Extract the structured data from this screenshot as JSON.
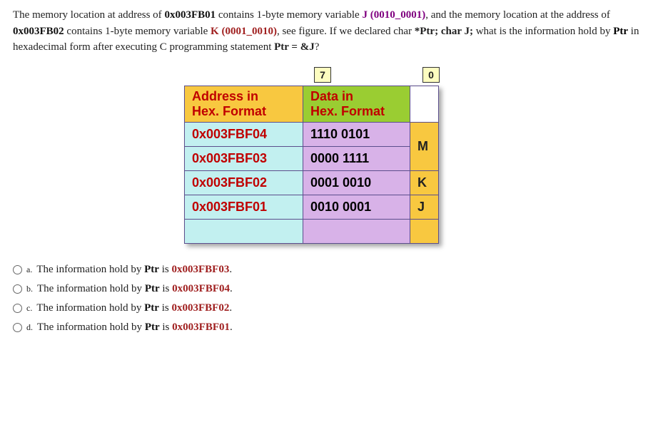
{
  "question": {
    "p1a": "The memory location at address of ",
    "addr1": "0x003FB01",
    "p1b": " contains 1-byte memory variable ",
    "varJ": "J (0010_0001)",
    "p1c": ", and the memory location at the address of ",
    "addr2": "0x003FB02",
    "p1d": " contains 1-byte memory variable ",
    "varK": "K (0001_0010)",
    "p1e": ", see figure. If we declared char ",
    "decl": "*Ptr; char J;",
    "p1f": " what is the information hold by ",
    "ptr": "Ptr",
    "p1g": " in hexadecimal form after executing C programming statement ",
    "stmt": "Ptr = &J",
    "p1h": "?"
  },
  "bits": {
    "hi": "7",
    "lo": "0"
  },
  "table": {
    "head": {
      "addr_l1": "Address in",
      "addr_l2": "Hex. Format",
      "data_l1": "Data in",
      "data_l2": "Hex. Format"
    },
    "rows": [
      {
        "addr": "0x003FBF04",
        "data": "1110 0101",
        "var": "M",
        "var_row": 0
      },
      {
        "addr": "0x003FBF03",
        "data": "0000 1111",
        "var": "",
        "var_row": 0
      },
      {
        "addr": "0x003FBF02",
        "data": "0001 0010",
        "var": "K",
        "var_row": 1
      },
      {
        "addr": "0x003FBF01",
        "data": "0010 0001",
        "var": "J",
        "var_row": 1
      }
    ]
  },
  "options": [
    {
      "letter": "a.",
      "pre": "The information hold by  ",
      "ptr": "Ptr",
      "mid": " is  ",
      "val": "0x003FBF03",
      "post": "."
    },
    {
      "letter": "b.",
      "pre": "The information hold by ",
      "ptr": "Ptr",
      "mid": " is  ",
      "val": "0x003FBF04",
      "post": "."
    },
    {
      "letter": "c.",
      "pre": "The information hold by ",
      "ptr": "Ptr",
      "mid": " is  ",
      "val": "0x003FBF02",
      "post": "."
    },
    {
      "letter": "d.",
      "pre": "The information hold by ",
      "ptr": "Ptr",
      "mid": " is  ",
      "val": "0x003FBF01",
      "post": "."
    }
  ]
}
